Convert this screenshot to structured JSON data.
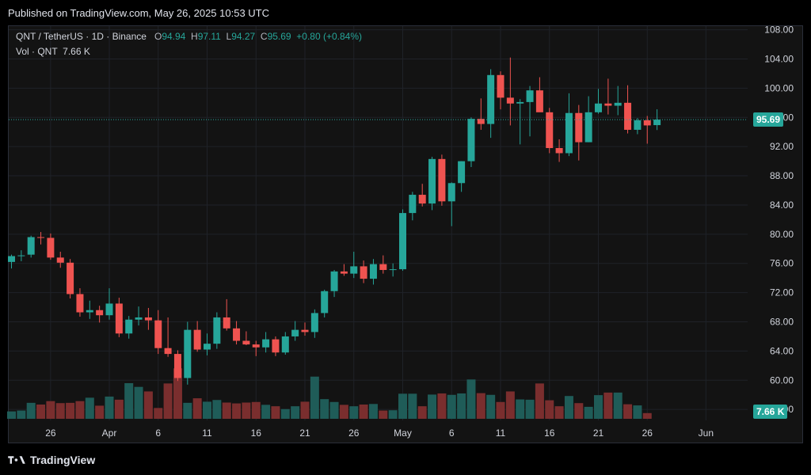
{
  "header": {
    "published": "Published on TradingView.com, May 26, 2025 10:53 UTC"
  },
  "legend": {
    "symbol": "QNT / TetherUS · 1D · Binance",
    "o_label": "O",
    "o_value": "94.94",
    "h_label": "H",
    "h_value": "97.11",
    "l_label": "L",
    "l_value": "94.27",
    "c_label": "C",
    "c_value": "95.69",
    "change": "+0.80 (+0.84%)",
    "vol_label": "Vol · QNT",
    "vol_value": "7.66 K"
  },
  "footer": {
    "brand": "TradingView"
  },
  "colors": {
    "up": "#26a69a",
    "down": "#ef5350",
    "up_vol": "#1f5c58",
    "down_vol": "#7a2e2e",
    "grid": "#1f2228",
    "bg": "#131313"
  },
  "chart_data": {
    "type": "candlestick",
    "y_ticks": [
      "56.00",
      "60.00",
      "64.00",
      "68.00",
      "72.00",
      "76.00",
      "80.00",
      "84.00",
      "88.00",
      "92.00",
      "96.00",
      "100.00",
      "104.00",
      "108.00"
    ],
    "ylim": [
      54.5,
      108.5
    ],
    "x_ticks": [
      {
        "label": "26",
        "index": 4
      },
      {
        "label": "Apr",
        "index": 10
      },
      {
        "label": "6",
        "index": 15
      },
      {
        "label": "11",
        "index": 20
      },
      {
        "label": "16",
        "index": 25
      },
      {
        "label": "21",
        "index": 30
      },
      {
        "label": "26",
        "index": 35
      },
      {
        "label": "May",
        "index": 40
      },
      {
        "label": "6",
        "index": 45
      },
      {
        "label": "11",
        "index": 50
      },
      {
        "label": "16",
        "index": 55
      },
      {
        "label": "21",
        "index": 60
      },
      {
        "label": "26",
        "index": 65
      },
      {
        "label": "Jun",
        "index": 71
      }
    ],
    "last_price": "95.69",
    "last_volume": "7.66 K",
    "candles": [
      [
        76.2,
        77.2,
        75.3,
        77.0
      ],
      [
        77.0,
        77.8,
        76.3,
        77.1
      ],
      [
        77.2,
        79.8,
        76.8,
        79.6
      ],
      [
        79.6,
        80.3,
        78.6,
        79.5
      ],
      [
        79.5,
        80.1,
        76.5,
        76.8
      ],
      [
        76.8,
        77.6,
        75.4,
        76.1
      ],
      [
        76.1,
        76.6,
        71.2,
        71.8
      ],
      [
        71.8,
        72.6,
        68.7,
        69.3
      ],
      [
        69.3,
        70.9,
        68.4,
        69.6
      ],
      [
        69.6,
        70.2,
        67.9,
        68.9
      ],
      [
        68.9,
        72.6,
        68.3,
        70.5
      ],
      [
        70.5,
        71.3,
        65.9,
        66.4
      ],
      [
        66.4,
        68.8,
        65.7,
        68.3
      ],
      [
        68.3,
        70.1,
        67.5,
        68.6
      ],
      [
        68.6,
        69.9,
        66.9,
        68.2
      ],
      [
        68.2,
        69.6,
        63.6,
        64.4
      ],
      [
        64.4,
        68.6,
        63.2,
        63.6
      ],
      [
        63.6,
        64.1,
        59.9,
        60.3
      ],
      [
        60.3,
        68.0,
        59.4,
        66.9
      ],
      [
        66.9,
        68.1,
        63.9,
        64.2
      ],
      [
        64.2,
        66.4,
        63.4,
        65.0
      ],
      [
        65.0,
        69.3,
        64.3,
        68.6
      ],
      [
        68.6,
        71.1,
        66.8,
        67.1
      ],
      [
        67.1,
        68.1,
        64.9,
        65.4
      ],
      [
        65.4,
        66.7,
        64.8,
        64.9
      ],
      [
        64.9,
        65.4,
        63.3,
        64.5
      ],
      [
        64.5,
        66.6,
        63.8,
        65.6
      ],
      [
        65.6,
        66.0,
        63.3,
        63.8
      ],
      [
        63.8,
        66.6,
        63.5,
        66.0
      ],
      [
        66.0,
        68.1,
        65.4,
        66.9
      ],
      [
        66.9,
        67.9,
        66.1,
        66.6
      ],
      [
        66.6,
        69.7,
        65.8,
        69.2
      ],
      [
        69.2,
        72.4,
        68.6,
        72.2
      ],
      [
        72.2,
        75.1,
        71.4,
        74.9
      ],
      [
        74.9,
        75.9,
        74.3,
        74.6
      ],
      [
        74.6,
        77.6,
        74.0,
        75.6
      ],
      [
        75.6,
        76.4,
        73.3,
        73.9
      ],
      [
        73.9,
        76.6,
        73.1,
        75.9
      ],
      [
        75.9,
        77.1,
        74.6,
        75.1
      ],
      [
        75.1,
        76.0,
        74.2,
        75.2
      ],
      [
        75.2,
        83.4,
        75.0,
        82.9
      ],
      [
        82.9,
        85.8,
        81.9,
        85.4
      ],
      [
        85.4,
        86.9,
        83.8,
        84.2
      ],
      [
        84.2,
        90.6,
        83.3,
        90.3
      ],
      [
        90.3,
        90.9,
        83.9,
        84.5
      ],
      [
        84.5,
        87.1,
        81.1,
        87.0
      ],
      [
        87.0,
        90.0,
        85.8,
        90.0
      ],
      [
        90.0,
        96.0,
        89.2,
        95.8
      ],
      [
        95.8,
        98.6,
        94.3,
        95.1
      ],
      [
        95.1,
        102.6,
        93.2,
        101.8
      ],
      [
        101.8,
        102.3,
        97.1,
        98.7
      ],
      [
        98.7,
        104.2,
        94.9,
        97.9
      ],
      [
        97.9,
        98.5,
        92.3,
        98.1
      ],
      [
        98.1,
        100.3,
        93.4,
        99.7
      ],
      [
        99.7,
        101.5,
        97.0,
        96.7
      ],
      [
        96.7,
        97.3,
        91.1,
        91.8
      ],
      [
        91.8,
        93.0,
        89.9,
        91.1
      ],
      [
        91.1,
        99.3,
        90.7,
        96.6
      ],
      [
        96.6,
        97.7,
        90.1,
        92.6
      ],
      [
        92.6,
        98.9,
        92.6,
        96.7
      ],
      [
        96.7,
        99.9,
        96.5,
        97.9
      ],
      [
        97.9,
        101.3,
        96.4,
        97.6
      ],
      [
        97.6,
        100.3,
        96.3,
        98.0
      ],
      [
        98.0,
        100.4,
        93.8,
        94.3
      ],
      [
        94.3,
        95.9,
        93.7,
        95.6
      ],
      [
        95.6,
        96.2,
        92.4,
        94.9
      ],
      [
        94.94,
        97.11,
        94.27,
        95.69
      ]
    ],
    "volumes": [
      2.6,
      2.9,
      5.6,
      5.0,
      6.2,
      5.5,
      5.6,
      6.2,
      7.4,
      4.6,
      7.8,
      6.7,
      12.5,
      11.2,
      9.6,
      3.8,
      12.4,
      17.7,
      5.6,
      7.2,
      6.0,
      6.6,
      5.7,
      5.4,
      5.7,
      5.9,
      4.9,
      4.4,
      3.4,
      4.4,
      6.0,
      14.8,
      6.9,
      5.9,
      4.9,
      4.4,
      5.0,
      5.2,
      2.9,
      3.0,
      8.8,
      8.8,
      4.4,
      8.5,
      8.9,
      8.4,
      8.9,
      13.8,
      9.0,
      8.4,
      5.9,
      9.6,
      6.8,
      6.7,
      12.4,
      6.5,
      4.4,
      8.0,
      5.5,
      4.2,
      8.3,
      9.2,
      9.2,
      5.1,
      4.7,
      2.0
    ]
  }
}
